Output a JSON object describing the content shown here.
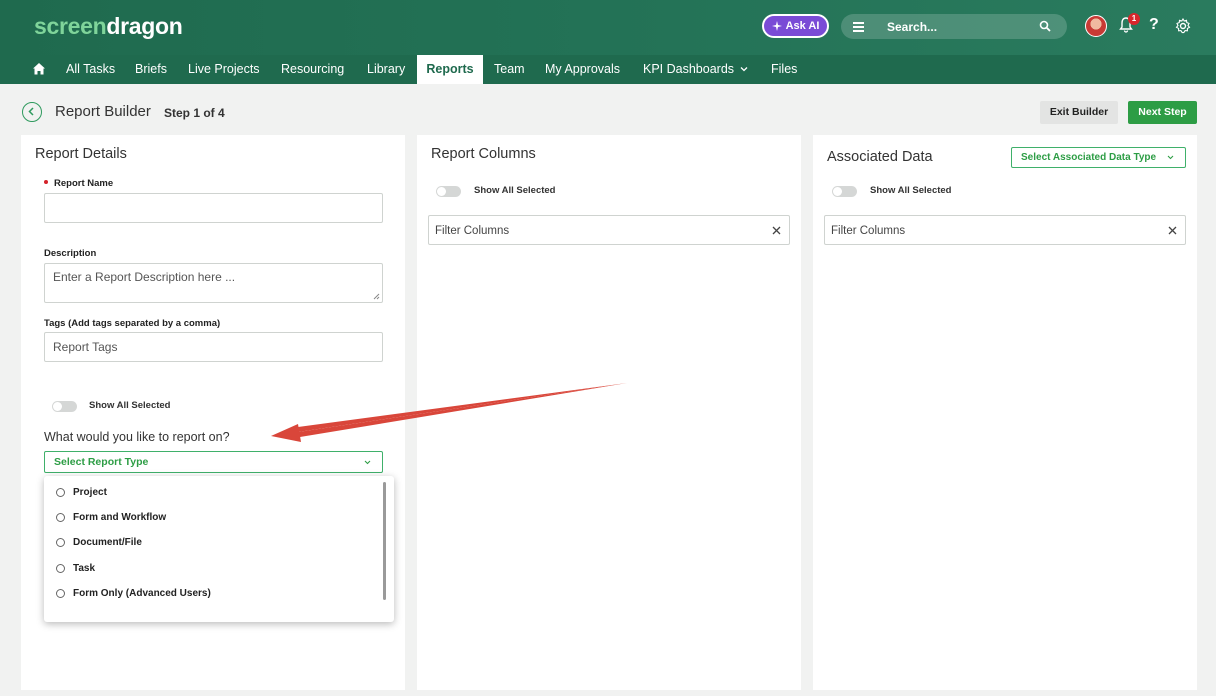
{
  "header": {
    "logo_part1": "screen",
    "logo_part2": "dragon",
    "ask_ai_label": "Ask AI",
    "search_placeholder": "Search...",
    "notification_count": "1",
    "help_label": "?"
  },
  "nav": {
    "items": [
      {
        "label": "All Tasks"
      },
      {
        "label": "Briefs"
      },
      {
        "label": "Live Projects"
      },
      {
        "label": "Resourcing"
      },
      {
        "label": "Library"
      },
      {
        "label": "Reports"
      },
      {
        "label": "Team"
      },
      {
        "label": "My Approvals"
      },
      {
        "label": "KPI Dashboards"
      },
      {
        "label": "Files"
      }
    ],
    "active": "Reports"
  },
  "builder": {
    "title": "Report Builder",
    "step": "Step 1 of 4",
    "exit_label": "Exit Builder",
    "next_label": "Next Step"
  },
  "report_details": {
    "title": "Report Details",
    "name_label": "Report Name",
    "name_value": "",
    "description_label": "Description",
    "description_placeholder": "Enter a Report Description here ...",
    "tags_label": "Tags (Add tags separated by a comma)",
    "tags_placeholder": "Report Tags",
    "show_all_label": "Show All Selected",
    "question": "What would you like to report on?",
    "select_placeholder": "Select Report Type",
    "options": [
      {
        "label": "Project"
      },
      {
        "label": "Form and Workflow"
      },
      {
        "label": "Document/File"
      },
      {
        "label": "Task"
      },
      {
        "label": "Form Only (Advanced Users)"
      }
    ]
  },
  "report_columns": {
    "title": "Report Columns",
    "show_all_label": "Show All Selected",
    "filter_placeholder": "Filter Columns"
  },
  "associated_data": {
    "title": "Associated Data",
    "select_label": "Select Associated Data Type",
    "show_all_label": "Show All Selected",
    "filter_placeholder": "Filter Columns"
  },
  "colors": {
    "header_green": "#1f6a4e",
    "accent_green": "#2d9d45",
    "ask_ai_purple": "#7a4bd6",
    "annotation_red": "#d9463a"
  }
}
